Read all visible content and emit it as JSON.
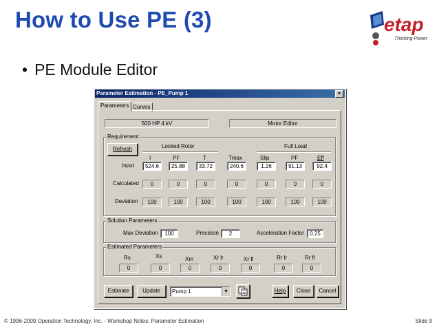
{
  "slide": {
    "title": "How to Use PE (3)",
    "bullet": "PE Module Editor",
    "logo_text": "etap",
    "logo_tagline": "Thinking Power",
    "footer": "© 1996-2009 Operation Technology, Inc. - Workshop Notes: Parameter Estimation",
    "slide_number": "Slide 9"
  },
  "dialog": {
    "title": "Parameter Estimation - PE_Pump 1",
    "close": "×",
    "tabs": [
      "Parameters",
      "Curves"
    ],
    "info_left": "500 HP  4 kV",
    "info_right": "Motor Editor",
    "requirement": {
      "label": "Requirement",
      "refresh": "Refresh",
      "locked_rotor": "Locked Rotor",
      "full_load": "Full Load",
      "columns": [
        "I",
        "PF",
        "T",
        "Tmax",
        "Slip",
        "PF",
        "Eff"
      ],
      "row_labels": [
        "Input",
        "Calculated",
        "Deviation"
      ],
      "input": [
        "524.6",
        "25.88",
        "33.72",
        "240.6",
        "1.26",
        "91.13",
        "92.4"
      ],
      "calculated": [
        "0",
        "0",
        "0",
        "0",
        "0",
        "0",
        "0"
      ],
      "deviation": [
        "100",
        "100",
        "100",
        "100",
        "100",
        "100",
        "100"
      ]
    },
    "solution": {
      "label": "Solution Parameters",
      "max_dev_label": "Max Deviation",
      "max_dev": "100",
      "precision_label": "Precision",
      "precision": "2",
      "accel_label": "Acceleration Factor",
      "accel": "0.25"
    },
    "estimated": {
      "label": "Estimated Parameters",
      "columns": [
        "Rs",
        "Xs",
        "Xm",
        "Xr lr",
        "Xr fl",
        "Rr lr",
        "Rr fl"
      ],
      "values": [
        "0",
        "0",
        "0",
        "0",
        "0",
        "0",
        "0"
      ]
    },
    "buttons": {
      "estimate": "Estimate",
      "update": "Update",
      "combo_value": "Pump 1",
      "help": "Help",
      "close": "Close",
      "cancel": "Cancel"
    }
  }
}
